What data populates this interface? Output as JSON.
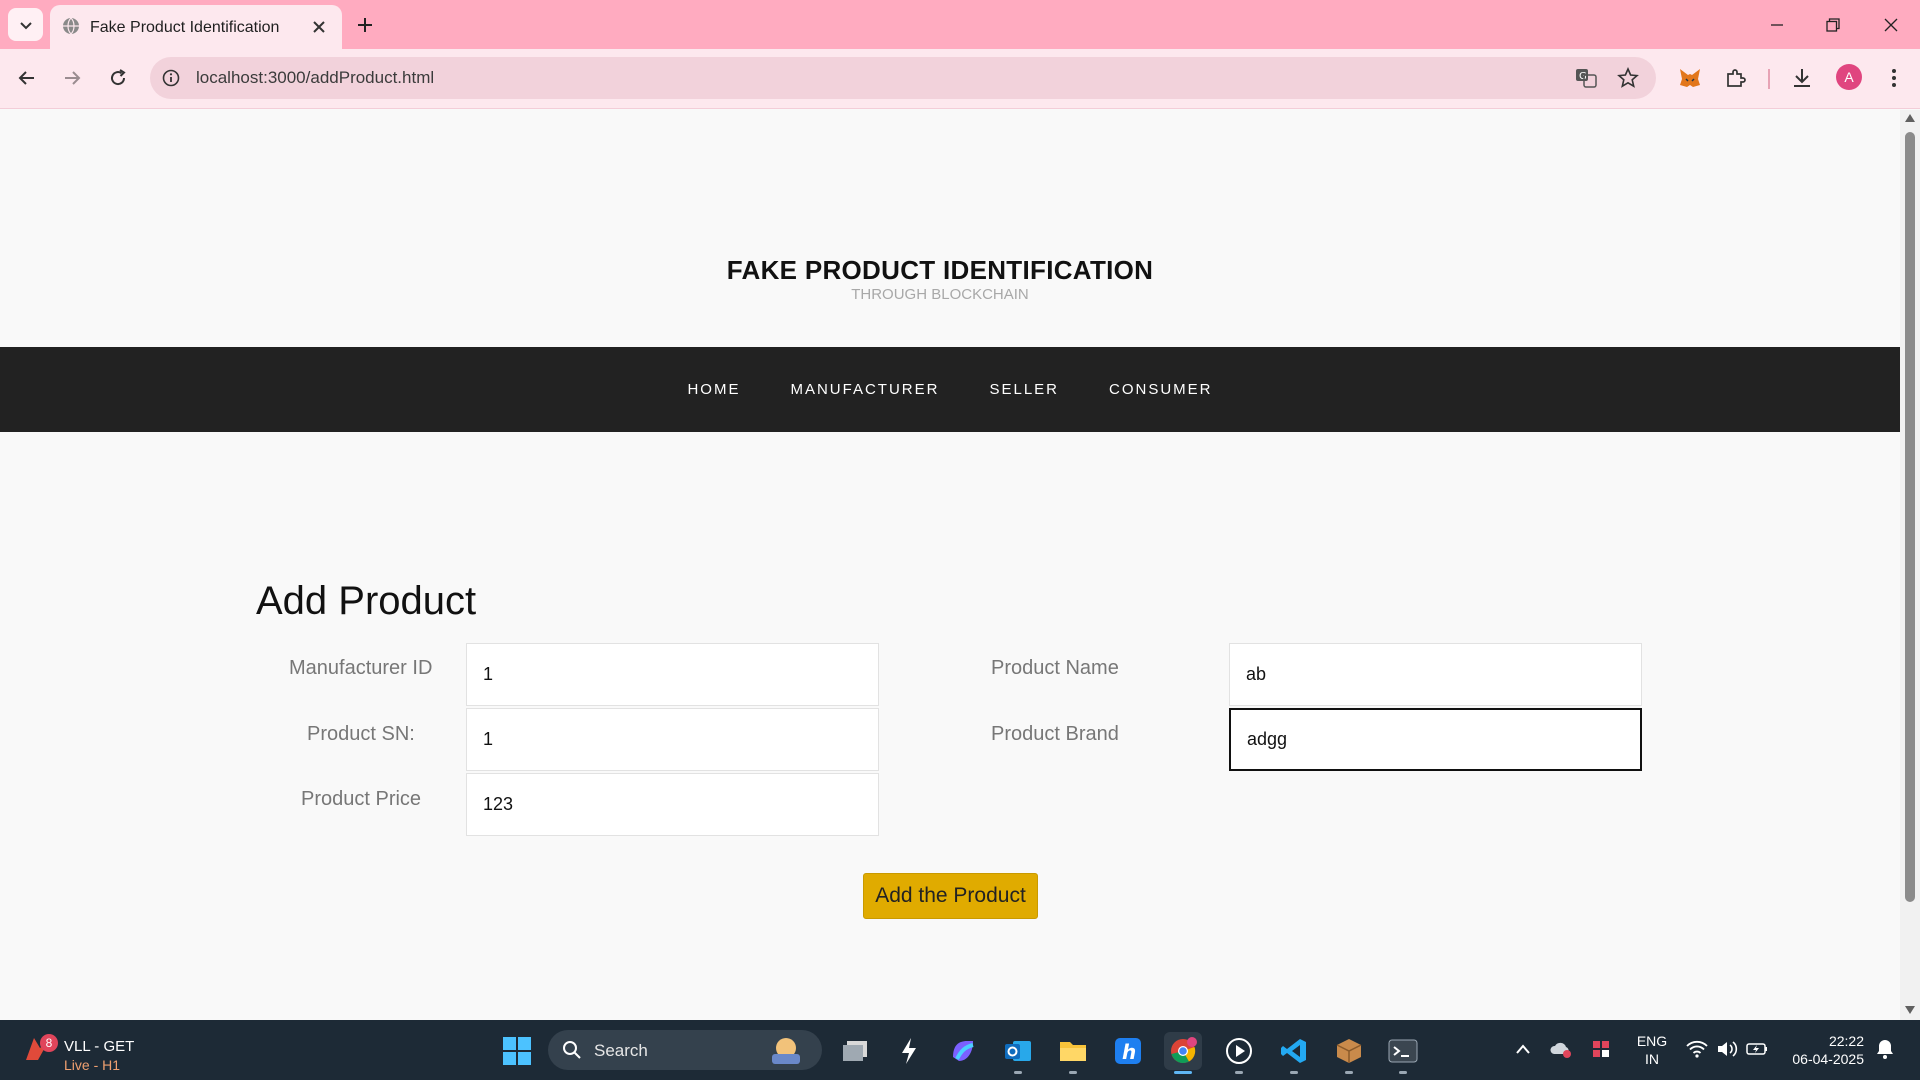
{
  "browser": {
    "tab_title": "Fake Product Identification",
    "url": "localhost:3000/addProduct.html",
    "profile_initial": "A"
  },
  "site": {
    "title": "FAKE PRODUCT IDENTIFICATION",
    "subtitle": "THROUGH BLOCKCHAIN",
    "nav": [
      "HOME",
      "MANUFACTURER",
      "SELLER",
      "CONSUMER"
    ]
  },
  "form": {
    "heading": "Add Product",
    "fields": {
      "manufacturer_id": {
        "label": "Manufacturer ID",
        "value": "1"
      },
      "product_sn": {
        "label": "Product SN:",
        "value": "1"
      },
      "product_price": {
        "label": "Product Price",
        "value": "123"
      },
      "product_name": {
        "label": "Product Name",
        "value": "ab"
      },
      "product_brand": {
        "label": "Product Brand",
        "value": "adgg"
      }
    },
    "submit_label": "Add the Product"
  },
  "taskbar": {
    "weather_badge": "8",
    "weather_line1": "VLL - GET",
    "weather_line2": "Live - H1",
    "search_label": "Search",
    "lang_line1": "ENG",
    "lang_line2": "IN",
    "time": "22:22",
    "date": "06-04-2025"
  },
  "colors": {
    "tabbar": "#ffabc0",
    "site_nav": "#222222",
    "submit": "#e0ab00",
    "taskbar": "#1d2a36"
  }
}
